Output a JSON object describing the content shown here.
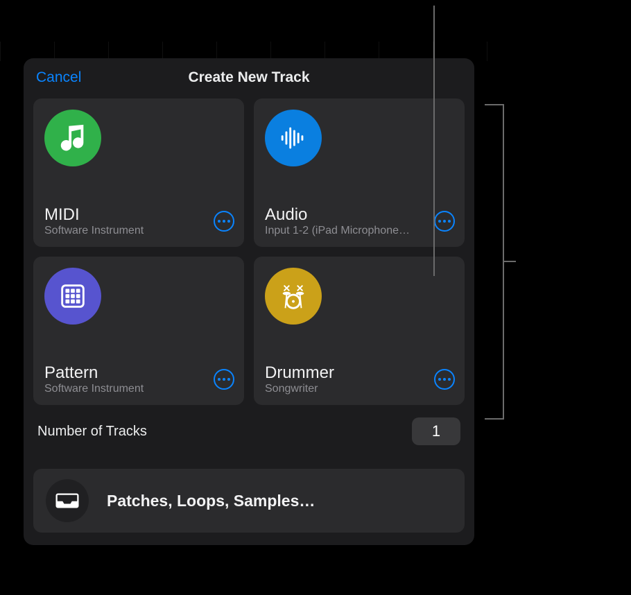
{
  "header": {
    "cancel_label": "Cancel",
    "title": "Create New Track"
  },
  "track_types": [
    {
      "id": "midi",
      "title": "MIDI",
      "subtitle": "Software Instrument",
      "icon_color": "#30b14a"
    },
    {
      "id": "audio",
      "title": "Audio",
      "subtitle": "Input 1-2  (iPad Microphone…",
      "icon_color": "#0a7fe0"
    },
    {
      "id": "pattern",
      "title": "Pattern",
      "subtitle": "Software Instrument",
      "icon_color": "#5754cf"
    },
    {
      "id": "drummer",
      "title": "Drummer",
      "subtitle": "Songwriter",
      "icon_color": "#cba119"
    }
  ],
  "number_of_tracks": {
    "label": "Number of Tracks",
    "value": "1"
  },
  "patches_row": {
    "label": "Patches, Loops, Samples…"
  }
}
